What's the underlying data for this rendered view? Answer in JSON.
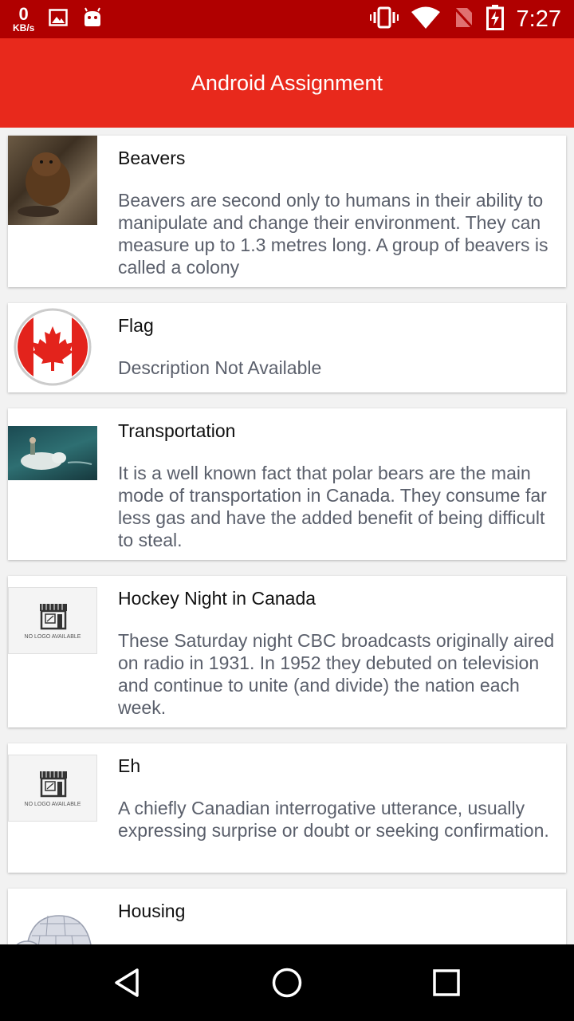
{
  "status_bar": {
    "net_speed_value": "0",
    "net_speed_unit": "KB/s",
    "time": "7:27",
    "icons": [
      "image-icon",
      "android-icon",
      "vibrate-icon",
      "wifi-icon",
      "no-sim-icon",
      "battery-charging-icon"
    ]
  },
  "toolbar": {
    "title": "Android Assignment"
  },
  "items": [
    {
      "title": "Beavers",
      "description": "Beavers are second only to humans in their ability to manipulate and change their environment. They can measure up to 1.3 metres long. A group of beavers is called a colony",
      "thumbnail": "beaver-photo"
    },
    {
      "title": "Flag",
      "description": "Description Not Available",
      "thumbnail": "canada-flag-badge"
    },
    {
      "title": "Transportation",
      "description": "It is a well known fact that polar bears are the main mode of transportation in Canada. They consume far less gas and have the added benefit of being difficult to steal.",
      "thumbnail": "polar-bear-photo"
    },
    {
      "title": "Hockey Night in Canada",
      "description": "These Saturday night CBC broadcasts originally aired on radio in 1931. In 1952 they debuted on television and continue to unite (and divide) the nation each week.",
      "thumbnail": "no-logo-placeholder",
      "placeholder_text": "NO LOGO AVAILABLE"
    },
    {
      "title": "Eh",
      "description": "A chiefly Canadian interrogative utterance, usually expressing surprise or doubt or seeking confirmation.",
      "thumbnail": "no-logo-placeholder",
      "placeholder_text": "NO LOGO AVAILABLE"
    },
    {
      "title": "Housing",
      "description": "",
      "thumbnail": "igloo-image"
    }
  ],
  "nav_bar": {
    "buttons": [
      "back-icon",
      "home-icon",
      "recents-icon"
    ]
  },
  "colors": {
    "status_bar": "#b00000",
    "toolbar": "#e8291c",
    "background": "#f2f2f2"
  }
}
